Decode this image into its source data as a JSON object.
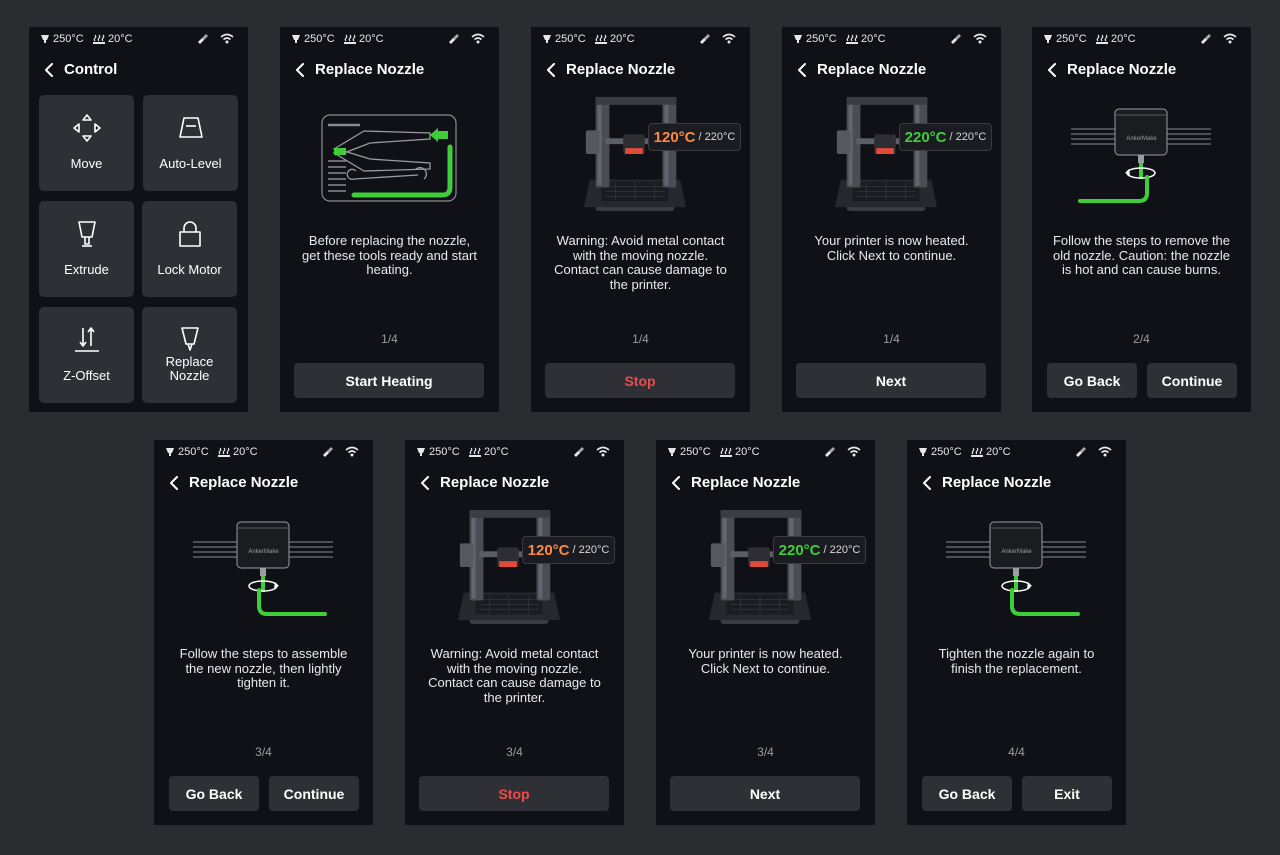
{
  "colors": {
    "background": "#2b2c2f",
    "screen_bg": "#0f1116",
    "button_bg": "#2e3035",
    "accent_green": "#3fce3a",
    "accent_orange": "#ff8a3d",
    "stop_red": "#f04b4b"
  },
  "status": {
    "nozzle_temp": "250°C",
    "bed_temp": "20°C"
  },
  "control_screen": {
    "title": "Control",
    "tiles": [
      {
        "label": "Move",
        "icon": "move-icon"
      },
      {
        "label": "Auto-Level",
        "icon": "auto-level-icon"
      },
      {
        "label": "Extrude",
        "icon": "extrude-icon"
      },
      {
        "label": "Lock Motor",
        "icon": "lock-icon"
      },
      {
        "label": "Z-Offset",
        "icon": "z-offset-icon"
      },
      {
        "label": "Replace\nNozzle",
        "icon": "nozzle-icon"
      }
    ]
  },
  "screens": [
    {
      "title": "Replace Nozzle",
      "desc": "Before replacing the nozzle,\nget these tools ready and start\nheating.",
      "step": "1/4",
      "buttons": [
        "Start Heating"
      ]
    },
    {
      "title": "Replace Nozzle",
      "desc": "Warning: Avoid metal contact\nwith the moving nozzle.\nContact can cause damage to\nthe printer.",
      "step": "1/4",
      "buttons": [
        "Stop"
      ],
      "current_temp": "120°C",
      "target_temp": "/ 220°C"
    },
    {
      "title": "Replace Nozzle",
      "desc": "Your printer is now heated.\nClick Next to continue.",
      "step": "1/4",
      "buttons": [
        "Next"
      ],
      "current_temp": "220°C",
      "target_temp": "/ 220°C"
    },
    {
      "title": "Replace Nozzle",
      "desc": "Follow the steps to remove the\nold nozzle. Caution: the nozzle\nis hot and can cause burns.",
      "step": "2/4",
      "buttons": [
        "Go Back",
        "Continue"
      ],
      "brand": "AnkerMake"
    },
    {
      "title": "Replace Nozzle",
      "desc": "Follow the steps to assemble\nthe new nozzle, then lightly\ntighten it.",
      "step": "3/4",
      "buttons": [
        "Go Back",
        "Continue"
      ],
      "brand": "AnkerMake"
    },
    {
      "title": "Replace Nozzle",
      "desc": "Warning: Avoid metal contact\nwith the moving nozzle.\nContact can cause damage to\nthe printer.",
      "step": "3/4",
      "buttons": [
        "Stop"
      ],
      "current_temp": "120°C",
      "target_temp": "/ 220°C"
    },
    {
      "title": "Replace Nozzle",
      "desc": "Your printer is now heated.\nClick Next to continue.",
      "step": "3/4",
      "buttons": [
        "Next"
      ],
      "current_temp": "220°C",
      "target_temp": "/ 220°C"
    },
    {
      "title": "Replace Nozzle",
      "desc": "Tighten the nozzle again to\nfinish the replacement.",
      "step": "4/4",
      "buttons": [
        "Go Back",
        "Exit"
      ],
      "brand": "AnkerMake"
    }
  ]
}
